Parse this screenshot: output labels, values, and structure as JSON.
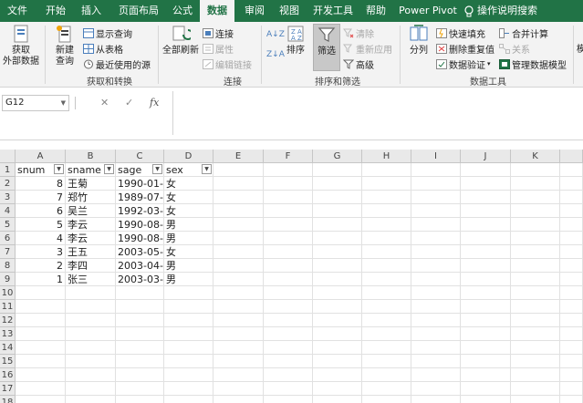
{
  "menu": {
    "tabs": [
      "文件",
      "开始",
      "插入",
      "页面布局",
      "公式",
      "数据",
      "审阅",
      "视图",
      "开发工具",
      "帮助",
      "Power Pivot"
    ],
    "active_tab": "数据",
    "search_label": "操作说明搜索"
  },
  "ribbon": {
    "get_external": "获取\n外部数据",
    "new_query": "新建\n查询",
    "show_queries": "显示查询",
    "from_table": "从表格",
    "recent_sources": "最近使用的源",
    "group_get": "获取和转换",
    "refresh_all": "全部刷新",
    "connections": "连接",
    "properties": "属性",
    "edit_links": "编辑链接",
    "group_conn": "连接",
    "sort": "排序",
    "filter": "筛选",
    "clear": "清除",
    "reapply": "重新应用",
    "advanced": "高级",
    "group_sort": "排序和筛选",
    "text_to_columns": "分列",
    "flash_fill": "快速填充",
    "remove_dupes": "删除重复值",
    "data_validation": "数据验证",
    "consolidate": "合并计算",
    "relationships": "关系",
    "manage_model": "管理数据模型",
    "group_tools": "数据工具",
    "cut_off": "模"
  },
  "formula_bar": {
    "name_box": "G12",
    "cancel": "✕",
    "enter": "✓",
    "fx": "fx",
    "value": ""
  },
  "grid": {
    "columns": [
      "A",
      "B",
      "C",
      "D",
      "E",
      "F",
      "G",
      "H",
      "I",
      "J",
      "K"
    ],
    "row_numbers": [
      "1",
      "2",
      "3",
      "4",
      "5",
      "6",
      "7",
      "8",
      "9",
      "10",
      "11",
      "12",
      "13",
      "14",
      "15",
      "16",
      "17",
      "18"
    ],
    "headers": [
      "snum",
      "sname",
      "sage",
      "sex"
    ],
    "rows": [
      [
        "8",
        "王菊",
        "1990-01-",
        "女"
      ],
      [
        "7",
        "郑竹",
        "1989-07-",
        "女"
      ],
      [
        "6",
        "吴兰",
        "1992-03-",
        "女"
      ],
      [
        "5",
        "李云",
        "1990-08-",
        "男"
      ],
      [
        "4",
        "李云",
        "1990-08-",
        "男"
      ],
      [
        "3",
        "王五",
        "2003-05-",
        "女"
      ],
      [
        "2",
        "李四",
        "2003-04-",
        "男"
      ],
      [
        "1",
        "张三",
        "2003-03-",
        "男"
      ]
    ]
  },
  "colors": {
    "brand": "#217346",
    "ribbon": "#f3f3f3",
    "header": "#e9e9e9"
  }
}
